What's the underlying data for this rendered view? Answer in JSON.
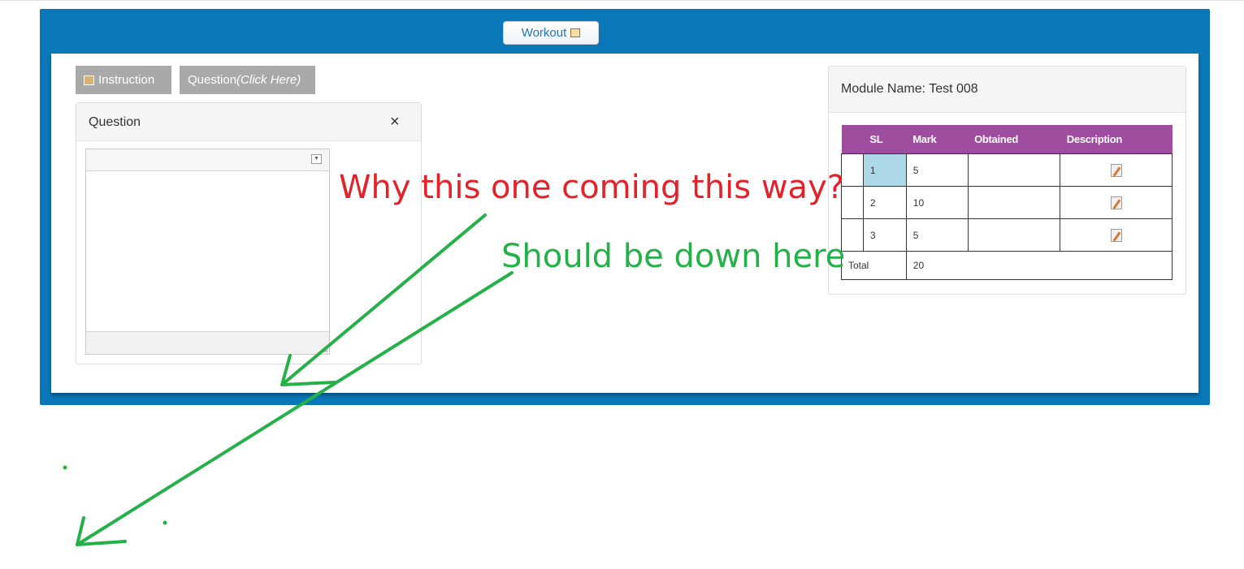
{
  "header": {
    "workout_label": "Workout",
    "workout_icon": "edit-icon"
  },
  "toolbar": {
    "instruction_label": "Instruction",
    "instruction_icon": "instruction-icon",
    "question_label": "Question",
    "question_hint": "(Click Here)"
  },
  "question_panel": {
    "title": "Question",
    "close_glyph": "×"
  },
  "module_panel": {
    "title": "Module Name: Test 008",
    "table": {
      "headers": [
        "",
        "SL",
        "Mark",
        "Obtained",
        "Description"
      ],
      "rows": [
        {
          "sl": "1",
          "mark": "5",
          "obtained": "",
          "description_icon": "edit-icon"
        },
        {
          "sl": "2",
          "mark": "10",
          "obtained": "",
          "description_icon": "edit-icon"
        },
        {
          "sl": "3",
          "mark": "5",
          "obtained": "",
          "description_icon": "edit-icon"
        }
      ],
      "total_label": "Total",
      "total_value": "20"
    }
  },
  "annotations": {
    "red_text": "Why this one coming this way?",
    "green_text": "Should be down here"
  },
  "colors": {
    "frame": "#0a77b8",
    "table_header": "#9e4d9f",
    "selected_cell": "#acd8e7",
    "annotation_red": "#e3232b",
    "annotation_green": "#25b04a"
  }
}
